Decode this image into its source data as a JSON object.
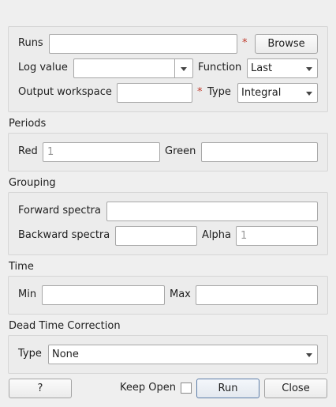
{
  "runs": {
    "label": "Runs",
    "value": "",
    "required_mark": "*",
    "browse_label": "Browse"
  },
  "log_value": {
    "label": "Log value",
    "value": ""
  },
  "function": {
    "label": "Function",
    "selected": "Last"
  },
  "output_workspace": {
    "label": "Output workspace",
    "value": "",
    "required_mark": "*"
  },
  "type": {
    "label": "Type",
    "selected": "Integral"
  },
  "periods": {
    "title": "Periods",
    "red_label": "Red",
    "red_placeholder": "1",
    "red_value": "",
    "green_label": "Green",
    "green_value": ""
  },
  "grouping": {
    "title": "Grouping",
    "forward_label": "Forward spectra",
    "forward_value": "",
    "backward_label": "Backward spectra",
    "backward_value": "",
    "alpha_label": "Alpha",
    "alpha_placeholder": "1",
    "alpha_value": ""
  },
  "time": {
    "title": "Time",
    "min_label": "Min",
    "min_value": "",
    "max_label": "Max",
    "max_value": ""
  },
  "dead_time": {
    "title": "Dead Time Correction",
    "type_label": "Type",
    "type_selected": "None"
  },
  "footer": {
    "help_label": "?",
    "keep_open_label": "Keep Open",
    "keep_open_checked": false,
    "run_label": "Run",
    "close_label": "Close"
  },
  "colors": {
    "required": "#c0392b",
    "default_button_border": "#5c7da8"
  },
  "icons": {
    "dropdown": "chevron-down-icon"
  }
}
